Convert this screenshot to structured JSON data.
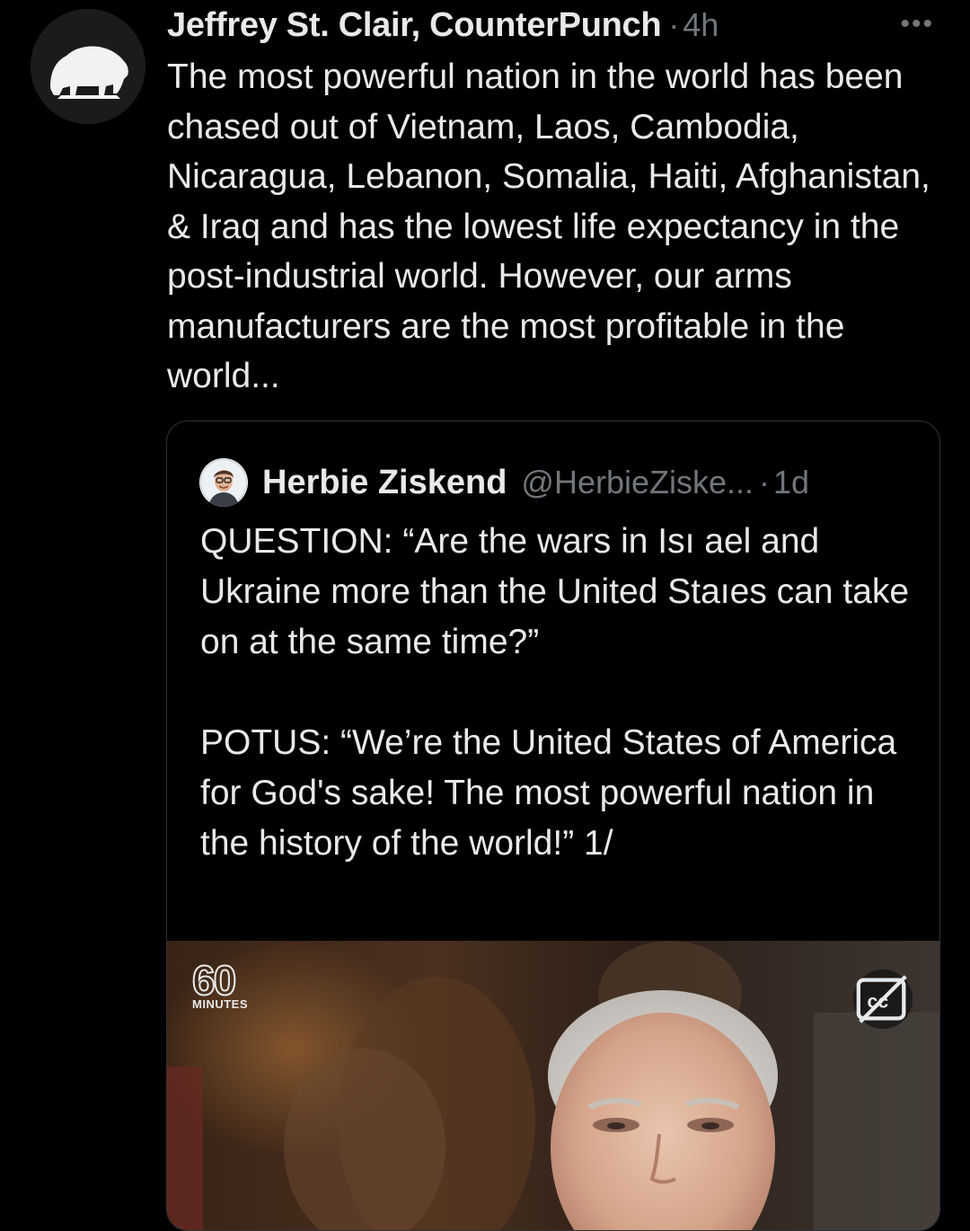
{
  "tweet": {
    "author": "Jeffrey St. Clair, CounterPunch",
    "separator": "·",
    "time": "4h",
    "more_icon": "more-horizontal-icon",
    "text": "The most powerful nation in the world has been chased out of Vietnam, Laos, Cambodia, Nicaragua, Lebanon, Somalia, Haiti, Afghanistan, & Iraq and has the lowest life expectancy in the post-industrial world. However, our arms manufacturers are the most profitable in the world..."
  },
  "quote": {
    "name": "Herbie Ziskend",
    "handle": "@HerbieZiske...",
    "separator": "·",
    "time": "1d",
    "paragraph_1": "QUESTION: “Are the wars in Isı ael and Ukraine more than the United Staıes can take on at the same time?”",
    "paragraph_2": "POTUS: “We’re the United States of America for God's sake! The most powerful nation in the history of the world!” 1/",
    "media": {
      "logo_number": "60",
      "logo_text": "MINUTES",
      "captions_icon": "closed-captions-off-icon"
    }
  },
  "colors": {
    "background": "#000000",
    "text_primary": "#e7e9ea",
    "text_secondary": "#71767b",
    "border": "#2f3336"
  }
}
